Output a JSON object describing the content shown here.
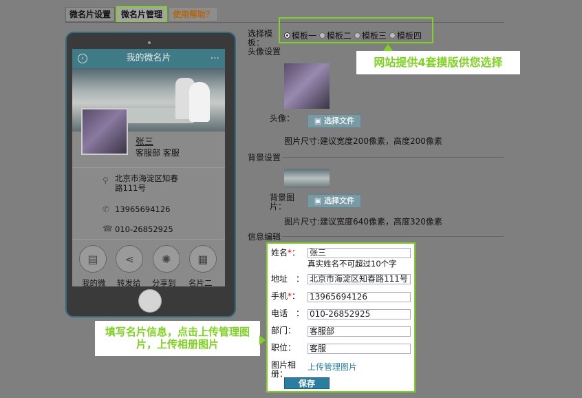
{
  "tabs": [
    {
      "label": "微名片设置"
    },
    {
      "label": "微名片管理"
    },
    {
      "label": "使用帮助？"
    }
  ],
  "phone": {
    "header_title": "我的微名片",
    "name": "张三",
    "department_role": "客服部 客服",
    "address": "北京市海淀区知春路111号",
    "phone": "13965694126",
    "tel": "010-26852925",
    "buttons": [
      "我的微",
      "转发给",
      "分享到",
      "名片二"
    ]
  },
  "form": {
    "template_label": "选择模板：",
    "templates": [
      "模板一",
      "模板二",
      "模板三",
      "模板四"
    ],
    "avatar_section": "头像设置",
    "avatar_label": "头像：",
    "file_button": "选择文件",
    "avatar_note": "图片尺寸:建议宽度200像素，高度200像素",
    "bg_section": "背景设置",
    "bg_label": "背景图片：",
    "bg_note": "图片尺寸:建议宽度640像素，高度320像素",
    "info_section": "信息编辑"
  },
  "edit": {
    "name_label": "姓名",
    "name_value": "张三",
    "name_hint": "真实姓名不可超过10个字",
    "address_label": "地址",
    "address_value": "北京市海淀区知春路111号",
    "mobile_label": "手机",
    "mobile_value": "13965694126",
    "tel_label": "电话",
    "tel_value": "010-26852925",
    "dept_label": "部门",
    "dept_value": "客服部",
    "position_label": "职位",
    "position_value": "客服",
    "album_label": "图片相册：",
    "album_link": "上传管理图片",
    "save_label": "保存"
  },
  "callouts": {
    "template_tip": "网站提供4套摸版供您选择",
    "info_tip": "填写名片信息，点击上传管理图片，上传相册图片"
  },
  "colors": {
    "highlight": "#7ed321",
    "accent": "#2a7ea0"
  }
}
